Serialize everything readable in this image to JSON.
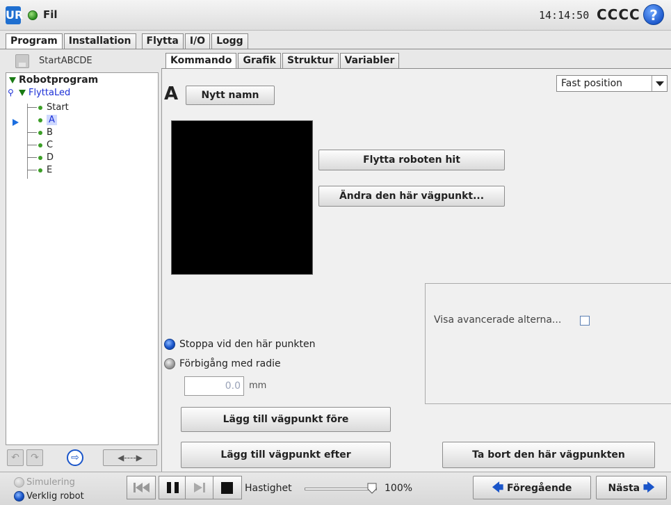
{
  "titlebar": {
    "logo": "UR",
    "file_menu": "Fil",
    "time": "14:14:50",
    "robot_name": "CCCC",
    "help_icon": "?"
  },
  "main_tabs": [
    {
      "label": "Program",
      "active": true
    },
    {
      "label": "Installation",
      "active": false
    },
    {
      "label": "Flytta",
      "active": false
    },
    {
      "label": "I/O",
      "active": false
    },
    {
      "label": "Logg",
      "active": false
    }
  ],
  "program": {
    "name": "StartABCDE"
  },
  "tree": {
    "root": "Robotprogram",
    "move_node": "FlyttaLed",
    "waypoints": [
      "Start",
      "A",
      "B",
      "C",
      "D",
      "E"
    ],
    "selected": "A"
  },
  "tree_toolbar": {
    "undo": "↶",
    "redo": "↷",
    "goto": "⇨",
    "move": "◀----▶"
  },
  "sub_tabs": [
    {
      "label": "Kommando",
      "active": true
    },
    {
      "label": "Grafik",
      "active": false
    },
    {
      "label": "Struktur",
      "active": false
    },
    {
      "label": "Variabler",
      "active": false
    }
  ],
  "waypoint": {
    "name": "A",
    "rename_button": "Nytt namn",
    "position_type": "Fast position",
    "move_here_button": "Flytta roboten hit",
    "edit_button": "Ändra den här vägpunkt...",
    "stop_option": "Stoppa vid den här punkten",
    "blend_option": "Förbigång med radie",
    "radius_value": "0.0",
    "radius_unit": "mm",
    "advanced_label": "Visa avancerade alterna...",
    "add_before_button": "Lägg till vägpunkt före",
    "add_after_button": "Lägg till vägpunkt efter",
    "remove_button": "Ta bort den här vägpunkten"
  },
  "bottom": {
    "simulation_label": "Simulering",
    "real_robot_label": "Verklig robot",
    "speed_label": "Hastighet",
    "speed_value": "100%",
    "speed_fraction": 1.0,
    "prev_button": "Föregående",
    "next_button": "Nästa"
  },
  "colors": {
    "accent": "#1a55c9",
    "tree_link": "#1b2fd6",
    "status_green": "#3c9e27"
  }
}
